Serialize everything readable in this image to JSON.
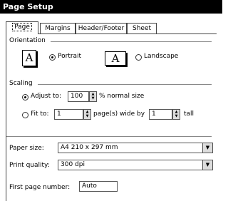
{
  "window": {
    "title": "Page Setup"
  },
  "tabs": [
    {
      "label": "Page",
      "active": true
    },
    {
      "label": "Margins",
      "active": false
    },
    {
      "label": "Header/Footer",
      "active": false
    },
    {
      "label": "Sheet",
      "active": false
    }
  ],
  "orientation": {
    "group_label": "Orientation",
    "portrait_label": "Portrait",
    "portrait_icon_glyph": "A",
    "landscape_label": "Landscape",
    "landscape_icon_glyph": "A",
    "selected": "portrait"
  },
  "scaling": {
    "group_label": "Scaling",
    "adjust_label": "Adjust to:",
    "adjust_value": "100",
    "adjust_suffix": "% normal size",
    "fit_label": "Fit to:",
    "fit_wide_value": "1",
    "fit_wide_suffix": "page(s) wide by",
    "fit_tall_value": "1",
    "fit_tall_suffix": "tall",
    "selected": "adjust"
  },
  "paper_size": {
    "label": "Paper size:",
    "value": "A4 210 x 297 mm"
  },
  "print_quality": {
    "label": "Print quality:",
    "value": "300 dpi"
  },
  "first_page_number": {
    "label": "First page number:",
    "value": "Auto"
  },
  "icons": {
    "spin_up": "▲",
    "spin_down": "▼",
    "dropdown": "▼"
  }
}
